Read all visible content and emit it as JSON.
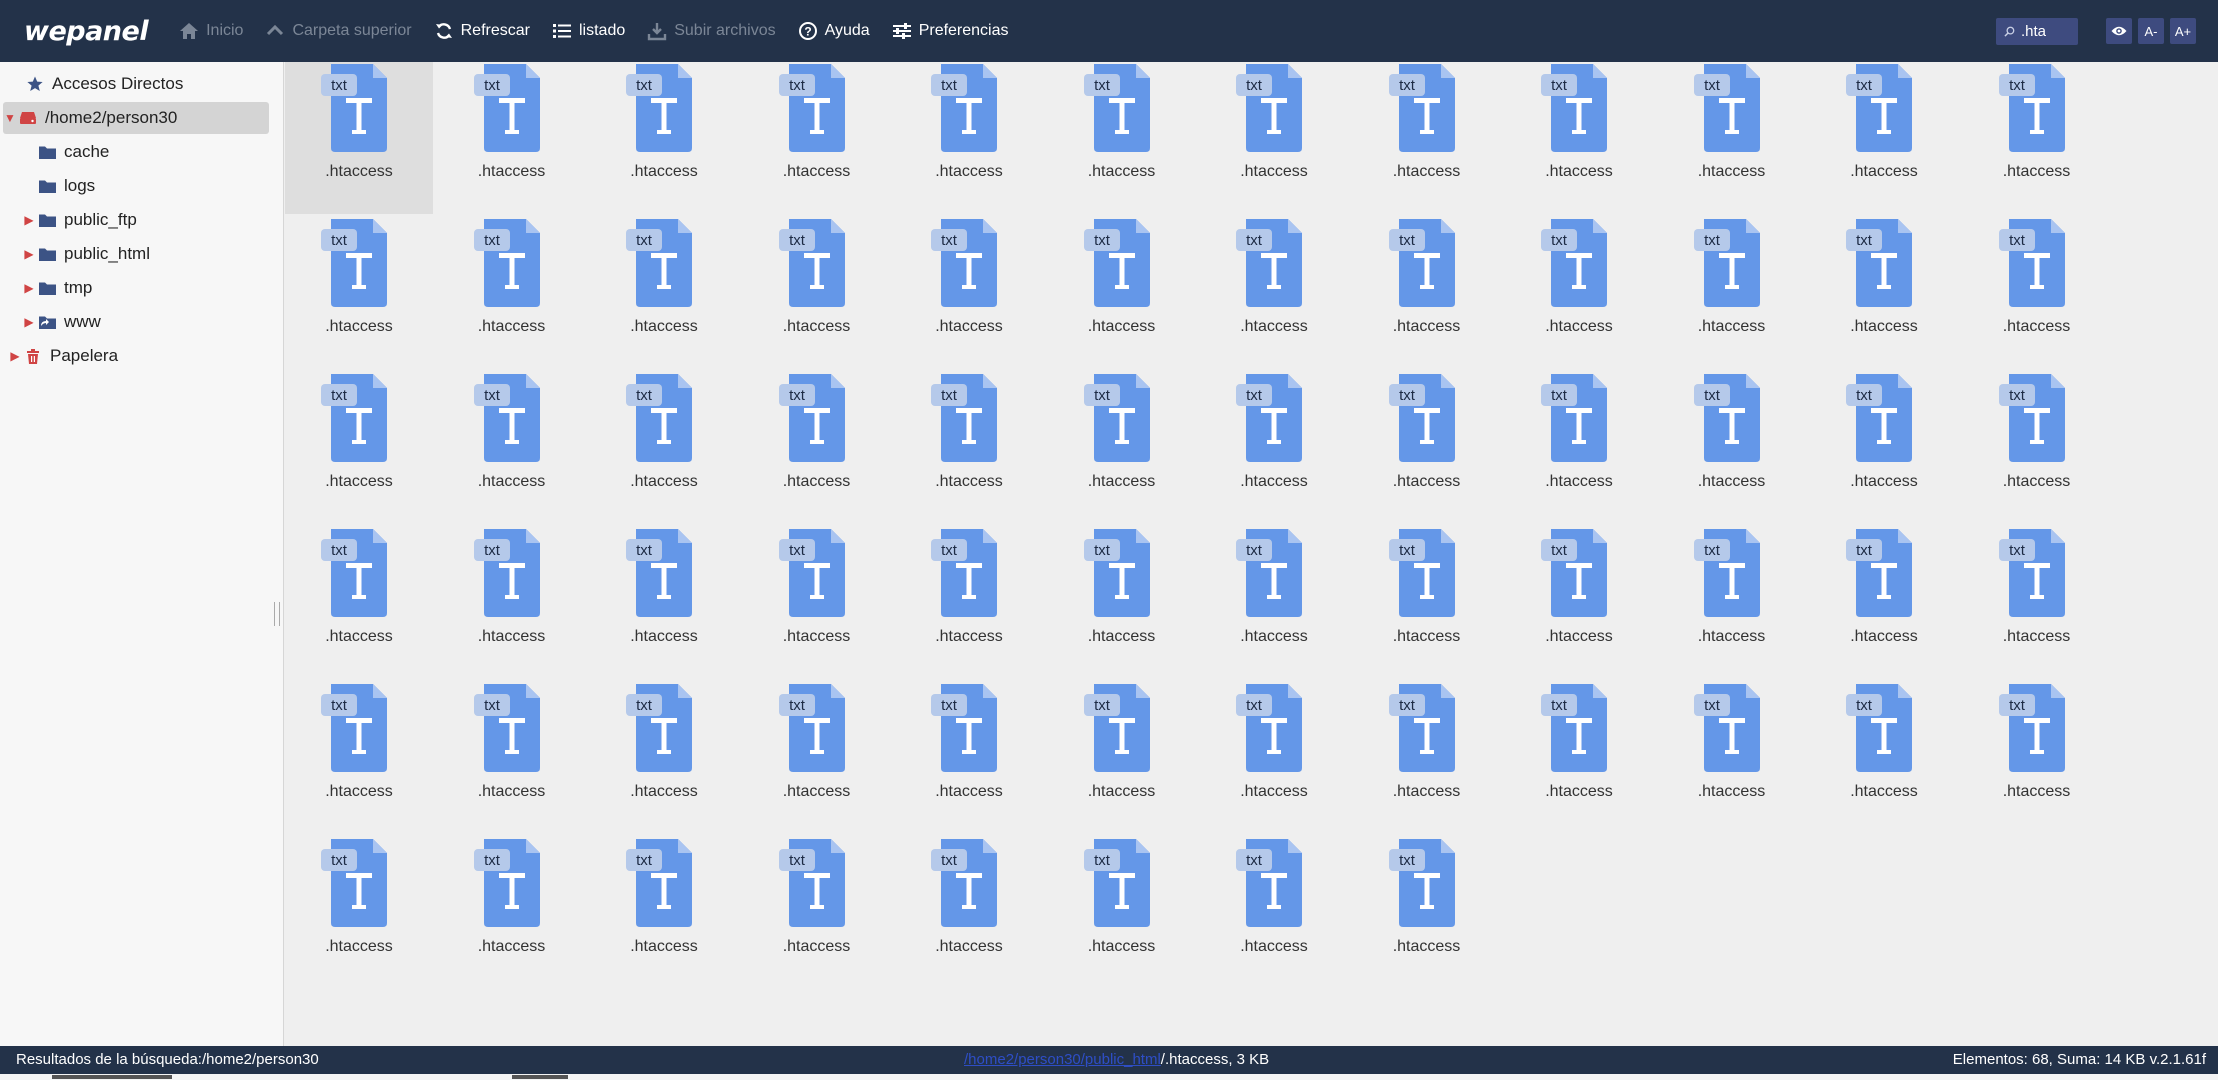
{
  "app": {
    "logo": "wepanel"
  },
  "toolbar": {
    "buttons": [
      {
        "label": "Inicio",
        "icon": "home-icon",
        "enabled": false
      },
      {
        "label": "Carpeta superior",
        "icon": "chevron-up-icon",
        "enabled": false
      },
      {
        "label": "Refrescar",
        "icon": "refresh-icon",
        "enabled": true
      },
      {
        "label": "listado",
        "icon": "list-icon",
        "enabled": true
      },
      {
        "label": "Subir archivos",
        "icon": "upload-icon",
        "enabled": false
      },
      {
        "label": "Ayuda",
        "icon": "help-icon",
        "enabled": true
      },
      {
        "label": "Preferencias",
        "icon": "sliders-icon",
        "enabled": true
      }
    ],
    "search": {
      "value": ".hta",
      "icon": "search-icon"
    },
    "view_toggle_icon": "eye-icon",
    "font_decrease_label": "A-",
    "font_increase_label": "A+"
  },
  "sidebar": {
    "favorites_label": "Accesos Directos",
    "root_label": "/home2/person30",
    "folders": [
      {
        "label": "cache",
        "expandable": false
      },
      {
        "label": "logs",
        "expandable": false
      },
      {
        "label": "public_ftp",
        "expandable": true
      },
      {
        "label": "public_html",
        "expandable": true
      },
      {
        "label": "tmp",
        "expandable": true
      },
      {
        "label": "www",
        "expandable": true,
        "symlink": true
      }
    ],
    "trash_label": "Papelera"
  },
  "files": {
    "count": 68,
    "columns": 12,
    "item": {
      "name": ".htaccess",
      "badge": "txt",
      "icon": "text-file-icon"
    },
    "selected_index": 0
  },
  "statusbar": {
    "search_results": "Resultados de la búsqueda:/home2/person30",
    "path_link": "/home2/person30/public_html",
    "path_suffix": "/.htaccess, 3 KB",
    "summary": "Elementos: 68, Suma: 14 KB v.2.1.61f"
  },
  "colors": {
    "toolbar_bg": "#233249",
    "file_icon": "#6497e8",
    "file_badge": "#b5c9ea",
    "accent_red": "#d04444",
    "folder": "#3c5385"
  }
}
